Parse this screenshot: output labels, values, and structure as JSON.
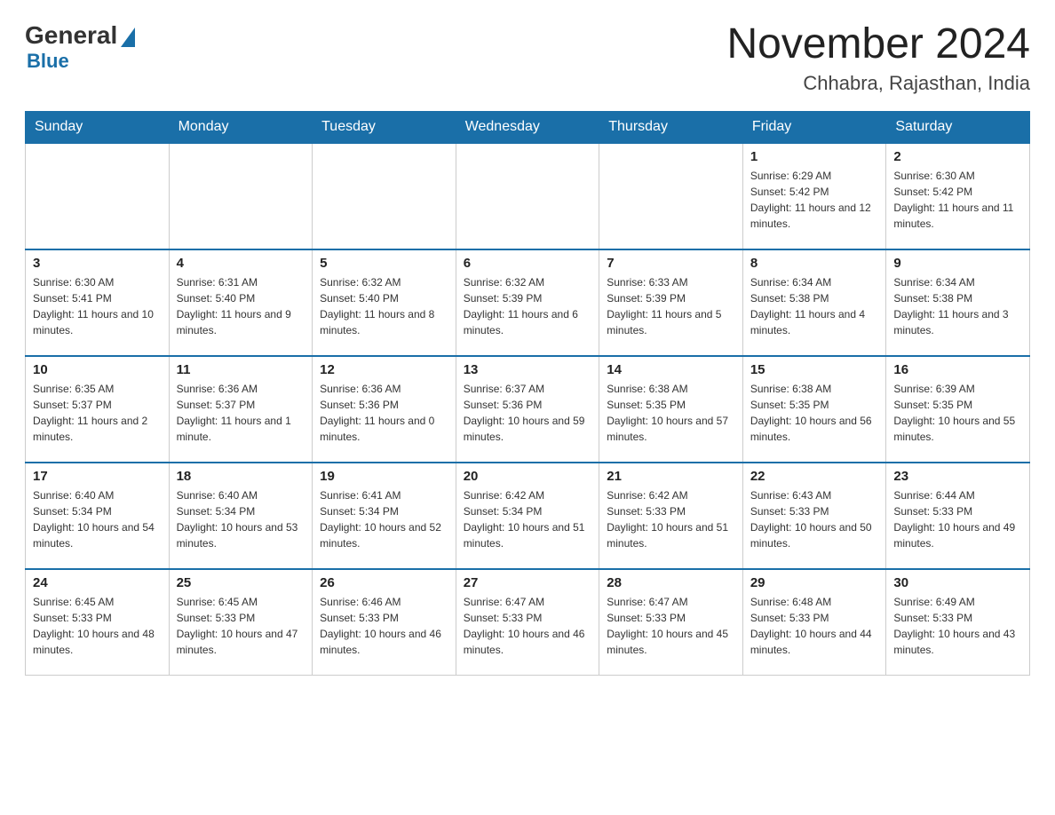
{
  "logo": {
    "general": "General",
    "blue": "Blue"
  },
  "header": {
    "title": "November 2024",
    "subtitle": "Chhabra, Rajasthan, India"
  },
  "weekdays": [
    "Sunday",
    "Monday",
    "Tuesday",
    "Wednesday",
    "Thursday",
    "Friday",
    "Saturday"
  ],
  "weeks": [
    [
      {
        "day": "",
        "sunrise": "",
        "sunset": "",
        "daylight": ""
      },
      {
        "day": "",
        "sunrise": "",
        "sunset": "",
        "daylight": ""
      },
      {
        "day": "",
        "sunrise": "",
        "sunset": "",
        "daylight": ""
      },
      {
        "day": "",
        "sunrise": "",
        "sunset": "",
        "daylight": ""
      },
      {
        "day": "",
        "sunrise": "",
        "sunset": "",
        "daylight": ""
      },
      {
        "day": "1",
        "sunrise": "Sunrise: 6:29 AM",
        "sunset": "Sunset: 5:42 PM",
        "daylight": "Daylight: 11 hours and 12 minutes."
      },
      {
        "day": "2",
        "sunrise": "Sunrise: 6:30 AM",
        "sunset": "Sunset: 5:42 PM",
        "daylight": "Daylight: 11 hours and 11 minutes."
      }
    ],
    [
      {
        "day": "3",
        "sunrise": "Sunrise: 6:30 AM",
        "sunset": "Sunset: 5:41 PM",
        "daylight": "Daylight: 11 hours and 10 minutes."
      },
      {
        "day": "4",
        "sunrise": "Sunrise: 6:31 AM",
        "sunset": "Sunset: 5:40 PM",
        "daylight": "Daylight: 11 hours and 9 minutes."
      },
      {
        "day": "5",
        "sunrise": "Sunrise: 6:32 AM",
        "sunset": "Sunset: 5:40 PM",
        "daylight": "Daylight: 11 hours and 8 minutes."
      },
      {
        "day": "6",
        "sunrise": "Sunrise: 6:32 AM",
        "sunset": "Sunset: 5:39 PM",
        "daylight": "Daylight: 11 hours and 6 minutes."
      },
      {
        "day": "7",
        "sunrise": "Sunrise: 6:33 AM",
        "sunset": "Sunset: 5:39 PM",
        "daylight": "Daylight: 11 hours and 5 minutes."
      },
      {
        "day": "8",
        "sunrise": "Sunrise: 6:34 AM",
        "sunset": "Sunset: 5:38 PM",
        "daylight": "Daylight: 11 hours and 4 minutes."
      },
      {
        "day": "9",
        "sunrise": "Sunrise: 6:34 AM",
        "sunset": "Sunset: 5:38 PM",
        "daylight": "Daylight: 11 hours and 3 minutes."
      }
    ],
    [
      {
        "day": "10",
        "sunrise": "Sunrise: 6:35 AM",
        "sunset": "Sunset: 5:37 PM",
        "daylight": "Daylight: 11 hours and 2 minutes."
      },
      {
        "day": "11",
        "sunrise": "Sunrise: 6:36 AM",
        "sunset": "Sunset: 5:37 PM",
        "daylight": "Daylight: 11 hours and 1 minute."
      },
      {
        "day": "12",
        "sunrise": "Sunrise: 6:36 AM",
        "sunset": "Sunset: 5:36 PM",
        "daylight": "Daylight: 11 hours and 0 minutes."
      },
      {
        "day": "13",
        "sunrise": "Sunrise: 6:37 AM",
        "sunset": "Sunset: 5:36 PM",
        "daylight": "Daylight: 10 hours and 59 minutes."
      },
      {
        "day": "14",
        "sunrise": "Sunrise: 6:38 AM",
        "sunset": "Sunset: 5:35 PM",
        "daylight": "Daylight: 10 hours and 57 minutes."
      },
      {
        "day": "15",
        "sunrise": "Sunrise: 6:38 AM",
        "sunset": "Sunset: 5:35 PM",
        "daylight": "Daylight: 10 hours and 56 minutes."
      },
      {
        "day": "16",
        "sunrise": "Sunrise: 6:39 AM",
        "sunset": "Sunset: 5:35 PM",
        "daylight": "Daylight: 10 hours and 55 minutes."
      }
    ],
    [
      {
        "day": "17",
        "sunrise": "Sunrise: 6:40 AM",
        "sunset": "Sunset: 5:34 PM",
        "daylight": "Daylight: 10 hours and 54 minutes."
      },
      {
        "day": "18",
        "sunrise": "Sunrise: 6:40 AM",
        "sunset": "Sunset: 5:34 PM",
        "daylight": "Daylight: 10 hours and 53 minutes."
      },
      {
        "day": "19",
        "sunrise": "Sunrise: 6:41 AM",
        "sunset": "Sunset: 5:34 PM",
        "daylight": "Daylight: 10 hours and 52 minutes."
      },
      {
        "day": "20",
        "sunrise": "Sunrise: 6:42 AM",
        "sunset": "Sunset: 5:34 PM",
        "daylight": "Daylight: 10 hours and 51 minutes."
      },
      {
        "day": "21",
        "sunrise": "Sunrise: 6:42 AM",
        "sunset": "Sunset: 5:33 PM",
        "daylight": "Daylight: 10 hours and 51 minutes."
      },
      {
        "day": "22",
        "sunrise": "Sunrise: 6:43 AM",
        "sunset": "Sunset: 5:33 PM",
        "daylight": "Daylight: 10 hours and 50 minutes."
      },
      {
        "day": "23",
        "sunrise": "Sunrise: 6:44 AM",
        "sunset": "Sunset: 5:33 PM",
        "daylight": "Daylight: 10 hours and 49 minutes."
      }
    ],
    [
      {
        "day": "24",
        "sunrise": "Sunrise: 6:45 AM",
        "sunset": "Sunset: 5:33 PM",
        "daylight": "Daylight: 10 hours and 48 minutes."
      },
      {
        "day": "25",
        "sunrise": "Sunrise: 6:45 AM",
        "sunset": "Sunset: 5:33 PM",
        "daylight": "Daylight: 10 hours and 47 minutes."
      },
      {
        "day": "26",
        "sunrise": "Sunrise: 6:46 AM",
        "sunset": "Sunset: 5:33 PM",
        "daylight": "Daylight: 10 hours and 46 minutes."
      },
      {
        "day": "27",
        "sunrise": "Sunrise: 6:47 AM",
        "sunset": "Sunset: 5:33 PM",
        "daylight": "Daylight: 10 hours and 46 minutes."
      },
      {
        "day": "28",
        "sunrise": "Sunrise: 6:47 AM",
        "sunset": "Sunset: 5:33 PM",
        "daylight": "Daylight: 10 hours and 45 minutes."
      },
      {
        "day": "29",
        "sunrise": "Sunrise: 6:48 AM",
        "sunset": "Sunset: 5:33 PM",
        "daylight": "Daylight: 10 hours and 44 minutes."
      },
      {
        "day": "30",
        "sunrise": "Sunrise: 6:49 AM",
        "sunset": "Sunset: 5:33 PM",
        "daylight": "Daylight: 10 hours and 43 minutes."
      }
    ]
  ]
}
